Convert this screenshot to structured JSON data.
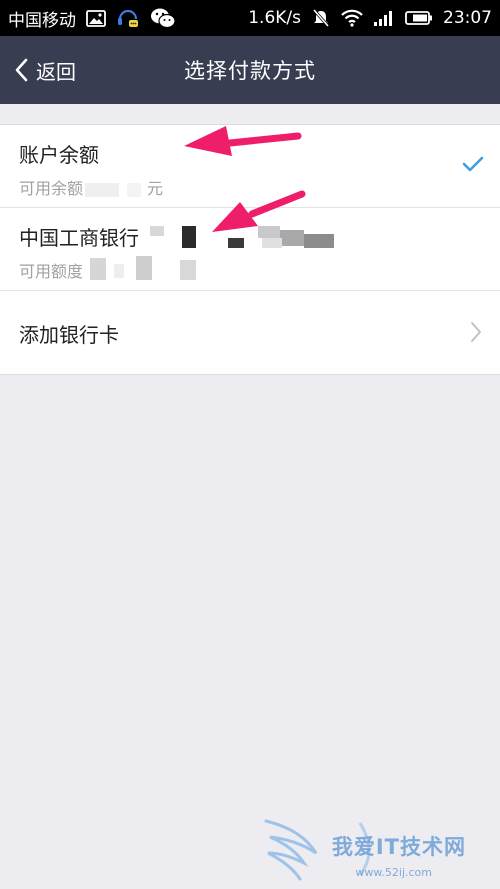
{
  "status_bar": {
    "carrier": "中国移动",
    "speed": "1.6K/s",
    "time": "23:07"
  },
  "nav": {
    "back_label": "返回",
    "title": "选择付款方式"
  },
  "payment_options": [
    {
      "title": "账户余额",
      "subtitle_prefix": "可用余额",
      "subtitle_suffix": "元",
      "selected": true
    },
    {
      "title": "中国工商银行",
      "subtitle_prefix": "可用额度"
    },
    {
      "title": "添加银行卡"
    }
  ],
  "watermark": {
    "text": "我爱IT技术网",
    "url": "www.52ij.com"
  },
  "colors": {
    "nav_bg": "#383d52",
    "accent_check": "#3aa0e8",
    "arrow": "#ef1e6b"
  }
}
